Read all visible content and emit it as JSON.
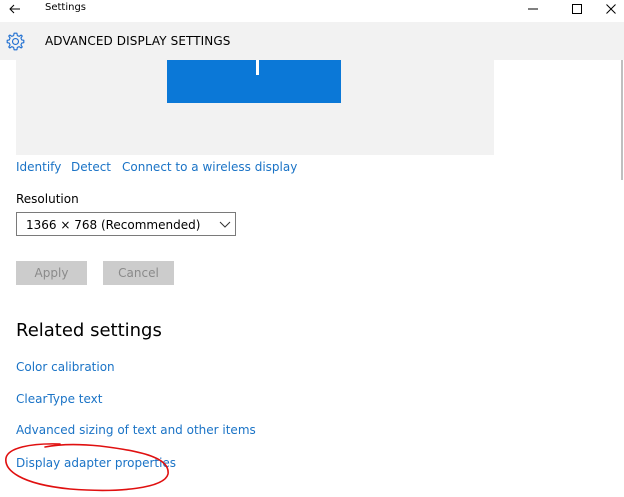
{
  "window": {
    "title": "Settings",
    "controls": {
      "minimize": "minimize",
      "maximize": "maximize",
      "close": "close"
    }
  },
  "header": {
    "title": "ADVANCED DISPLAY SETTINGS"
  },
  "display_links": {
    "identify": "Identify",
    "detect": "Detect",
    "connect": "Connect to a wireless display"
  },
  "resolution": {
    "label": "Resolution",
    "selected": "1366 × 768 (Recommended)"
  },
  "buttons": {
    "apply": "Apply",
    "cancel": "Cancel"
  },
  "related": {
    "title": "Related settings",
    "items": [
      {
        "label": "Color calibration"
      },
      {
        "label": "ClearType text"
      },
      {
        "label": "Advanced sizing of text and other items"
      },
      {
        "label": "Display adapter properties"
      }
    ]
  },
  "colors": {
    "accent": "#0b78d7",
    "link": "#1a73c6",
    "annotation": "#e01010"
  },
  "icons": {
    "back": "back-arrow-icon",
    "header": "gear-icon",
    "dropdown": "chevron-down-icon"
  }
}
